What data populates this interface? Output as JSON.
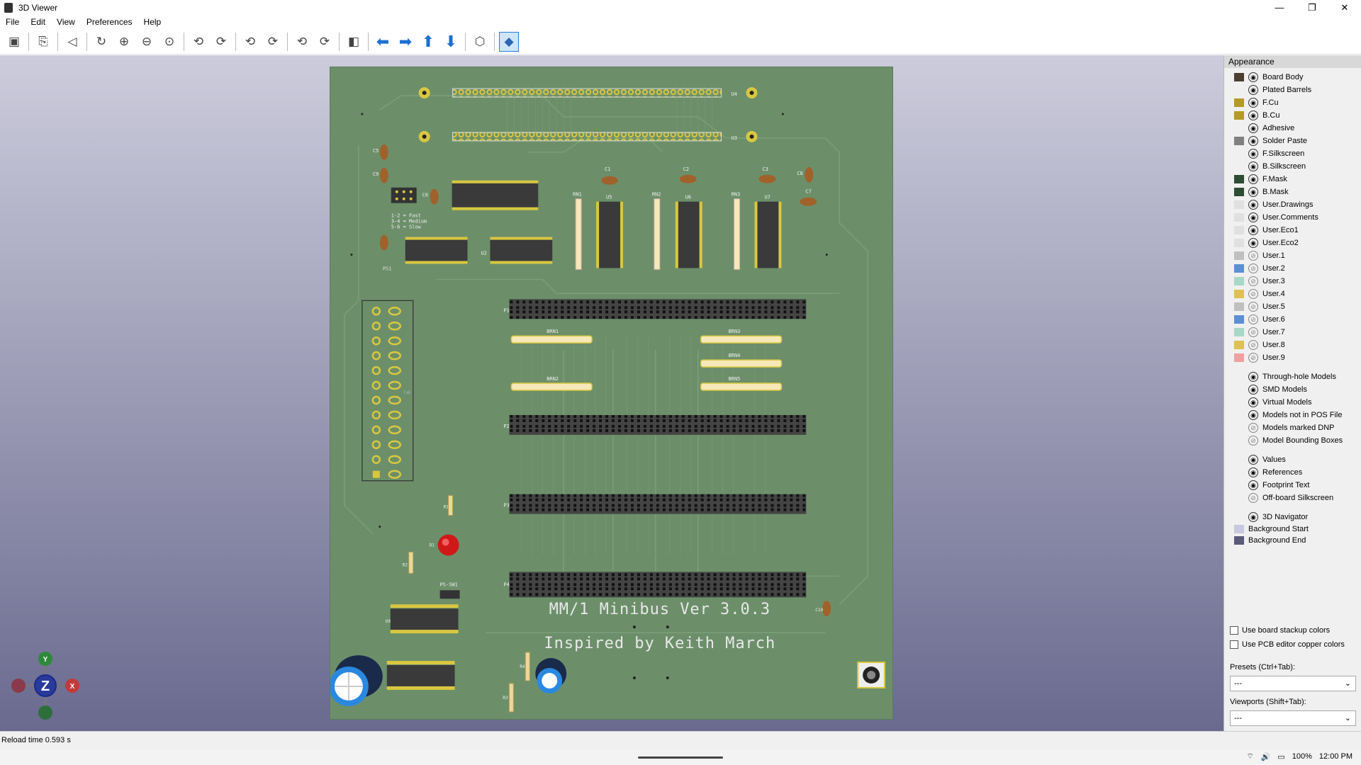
{
  "window": {
    "title": "3D Viewer",
    "minimize": "—",
    "restore": "❐",
    "close": "✕"
  },
  "menu": [
    "File",
    "Edit",
    "View",
    "Preferences",
    "Help"
  ],
  "toolbar_icons": [
    "render-icon",
    "copy-icon",
    "raytrace-icon",
    "reload-icon",
    "zoom-in-icon",
    "zoom-out-icon",
    "zoom-fit-icon",
    "rotate-x-cw-icon",
    "rotate-x-ccw-icon",
    "rotate-y-cw-icon",
    "rotate-y-ccw-icon",
    "rotate-z-cw-icon",
    "rotate-z-ccw-icon",
    "flip-board-icon",
    "pan-left-icon",
    "pan-right-icon",
    "pan-up-icon",
    "pan-down-icon",
    "ortho-icon",
    "layers-icon"
  ],
  "board": {
    "title_line1": "MM/1 Minibus Ver 3.0.3",
    "title_line2": "Inspired by Keith March",
    "legend": [
      "1-2 = Fast",
      "3-4 = Medium",
      "5-6 = Slow"
    ],
    "refs": {
      "u4": "U4",
      "u3": "U3",
      "c5": "C5",
      "c9": "C9",
      "c6": "C6",
      "c1": "C1",
      "c2": "C2",
      "c3": "C3",
      "c8": "C8",
      "c7": "C7",
      "rn1": "RN1",
      "rn2": "RN2",
      "rn3": "RN3",
      "u5": "U5",
      "u6": "U6",
      "u7": "U7",
      "u2": "U2",
      "ps1": "PS1",
      "p1": "P1",
      "p2": "P2",
      "p3": "P3",
      "p4": "P4",
      "brn1": "BRN1",
      "brn2": "BRN2",
      "brn3": "BRN3",
      "brn4": "BRN4",
      "brn5": "BRN5",
      "r1": "R1",
      "d1": "D1",
      "r2": "R2",
      "pssw1": "PS-SW1",
      "u9": "U9",
      "r4": "R4",
      "r3": "R3",
      "c10": "C10",
      "tab": "Tab"
    }
  },
  "axis": {
    "y": "Y",
    "z": "Z",
    "x": "X"
  },
  "appearance": {
    "header": "Appearance",
    "layers": [
      {
        "name": "Board Body",
        "color": "#4a3f30",
        "visible": true
      },
      {
        "name": "Plated Barrels",
        "color": "",
        "visible": true
      },
      {
        "name": "F.Cu",
        "color": "#b59a24",
        "visible": true
      },
      {
        "name": "B.Cu",
        "color": "#b59a24",
        "visible": true
      },
      {
        "name": "Adhesive",
        "color": "",
        "visible": true
      },
      {
        "name": "Solder Paste",
        "color": "#808080",
        "visible": true
      },
      {
        "name": "F.Silkscreen",
        "color": "#f0f0f0",
        "visible": true
      },
      {
        "name": "B.Silkscreen",
        "color": "#f0f0f0",
        "visible": true
      },
      {
        "name": "F.Mask",
        "color": "#2d4c34",
        "visible": true
      },
      {
        "name": "B.Mask",
        "color": "#2d4c34",
        "visible": true
      },
      {
        "name": "User.Drawings",
        "color": "#e0e0e0",
        "visible": true
      },
      {
        "name": "User.Comments",
        "color": "#e0e0e0",
        "visible": true
      },
      {
        "name": "User.Eco1",
        "color": "#e0e0e0",
        "visible": true
      },
      {
        "name": "User.Eco2",
        "color": "#e0e0e0",
        "visible": true
      },
      {
        "name": "User.1",
        "color": "#c0c0c0",
        "visible": false
      },
      {
        "name": "User.2",
        "color": "#5b8fd8",
        "visible": false
      },
      {
        "name": "User.3",
        "color": "#a8d8c8",
        "visible": false
      },
      {
        "name": "User.4",
        "color": "#e0c050",
        "visible": false
      },
      {
        "name": "User.5",
        "color": "#c0c0c0",
        "visible": false
      },
      {
        "name": "User.6",
        "color": "#5b8fd8",
        "visible": false
      },
      {
        "name": "User.7",
        "color": "#a8d8c8",
        "visible": false
      },
      {
        "name": "User.8",
        "color": "#e0c050",
        "visible": false
      },
      {
        "name": "User.9",
        "color": "#f0a0a0",
        "visible": false
      }
    ],
    "models": [
      {
        "name": "Through-hole Models",
        "visible": true
      },
      {
        "name": "SMD Models",
        "visible": true
      },
      {
        "name": "Virtual Models",
        "visible": true
      },
      {
        "name": "Models not in POS File",
        "visible": true
      },
      {
        "name": "Models marked DNP",
        "visible": false
      },
      {
        "name": "Model Bounding Boxes",
        "visible": false
      }
    ],
    "texts": [
      {
        "name": "Values",
        "visible": true
      },
      {
        "name": "References",
        "visible": true
      },
      {
        "name": "Footprint Text",
        "visible": true
      },
      {
        "name": "Off-board Silkscreen",
        "visible": false
      }
    ],
    "nav": {
      "name": "3D Navigator",
      "visible": true
    },
    "bg": [
      {
        "name": "Background Start",
        "color": "#c8c8e0"
      },
      {
        "name": "Background End",
        "color": "#5a5a7a"
      }
    ],
    "use_stackup": "Use board stackup colors",
    "use_pcb_colors": "Use PCB editor copper colors",
    "presets_label": "Presets (Ctrl+Tab):",
    "presets_value": "---",
    "viewports_label": "Viewports (Shift+Tab):",
    "viewports_value": "---"
  },
  "status": {
    "message": "Reload time 0.593 s"
  },
  "tray": {
    "battery": "100%",
    "time": "12:00 PM"
  }
}
